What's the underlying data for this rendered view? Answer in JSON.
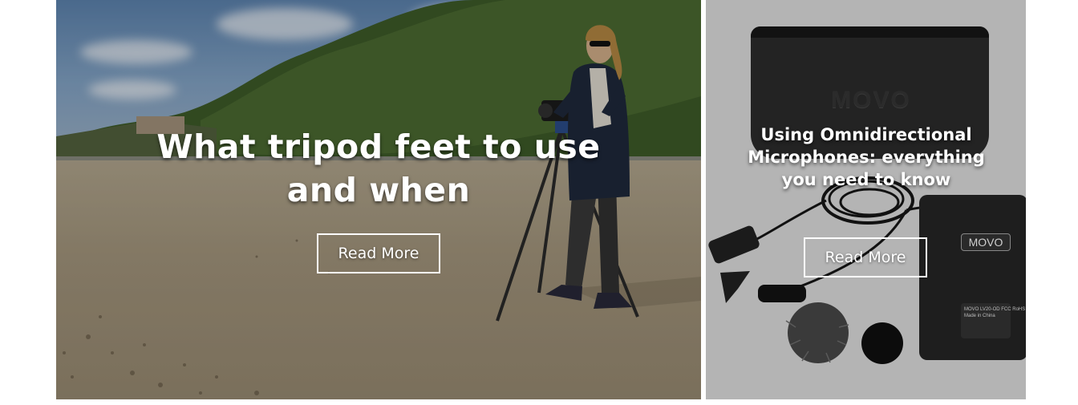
{
  "cards": [
    {
      "title": "What tripod feet to use and when",
      "button_label": "Read More"
    },
    {
      "title": "Using Omnidirectional Microphones: everything you need to know",
      "button_label": "Read More",
      "product_brand": "MOVO",
      "transmitter_label": "MOVO LV20-OD FCC RoHS Made in China"
    }
  ],
  "colors": {
    "button_border": "#ffffff",
    "title_text": "#ffffff",
    "card2_background": "#b4b4b4"
  }
}
